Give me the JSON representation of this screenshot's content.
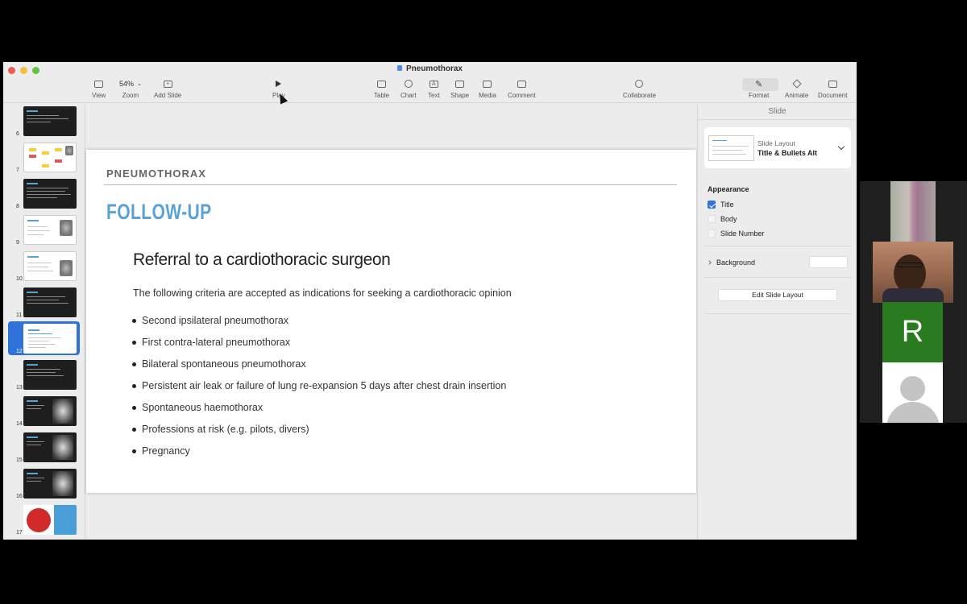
{
  "app": {
    "document_title": "Pneumothorax"
  },
  "toolbar": {
    "view": "View",
    "zoom_value": "54%",
    "zoom": "Zoom",
    "add_slide": "Add Slide",
    "play": "Play",
    "table": "Table",
    "chart": "Chart",
    "text": "Text",
    "shape": "Shape",
    "media": "Media",
    "comment": "Comment",
    "collaborate": "Collaborate",
    "format": "Format",
    "animate": "Animate",
    "document": "Document"
  },
  "navigator": {
    "slides": [
      {
        "number": "6"
      },
      {
        "number": "7"
      },
      {
        "number": "8"
      },
      {
        "number": "9"
      },
      {
        "number": "10"
      },
      {
        "number": "11"
      },
      {
        "number": "12"
      },
      {
        "number": "13"
      },
      {
        "number": "14"
      },
      {
        "number": "15"
      },
      {
        "number": "16"
      },
      {
        "number": "17"
      }
    ],
    "selected": "12"
  },
  "slide": {
    "header": "PNEUMOTHORAX",
    "title": "FOLLOW-UP",
    "subtitle": "Referral to a cardiothoracic surgeon",
    "intro": "The following criteria are accepted as indications for seeking a cardiothoracic opinion",
    "bullets": [
      "Second ipsilateral pneumothorax",
      "First contra-lateral pneumothorax",
      "Bilateral spontaneous pneumothorax",
      "Persistent air leak or failure of lung re-expansion 5 days after chest drain insertion",
      "Spontaneous haemothorax",
      "Professions at risk (e.g. pilots, divers)",
      "Pregnancy"
    ],
    "title_color": "#5aa2d6"
  },
  "inspector": {
    "tab": "Slide",
    "layout_caption": "Slide Layout",
    "layout_name": "Title & Bullets Alt",
    "appearance": "Appearance",
    "title_cb": "Title",
    "title_checked": true,
    "body_cb": "Body",
    "body_checked": false,
    "number_cb": "Slide Number",
    "number_checked": false,
    "background": "Background",
    "edit_layout": "Edit Slide Layout"
  },
  "video": {
    "participant_initial": "R"
  },
  "colors": {
    "accent": "#2f72d8",
    "participant_tile": "#2a7a1f"
  }
}
